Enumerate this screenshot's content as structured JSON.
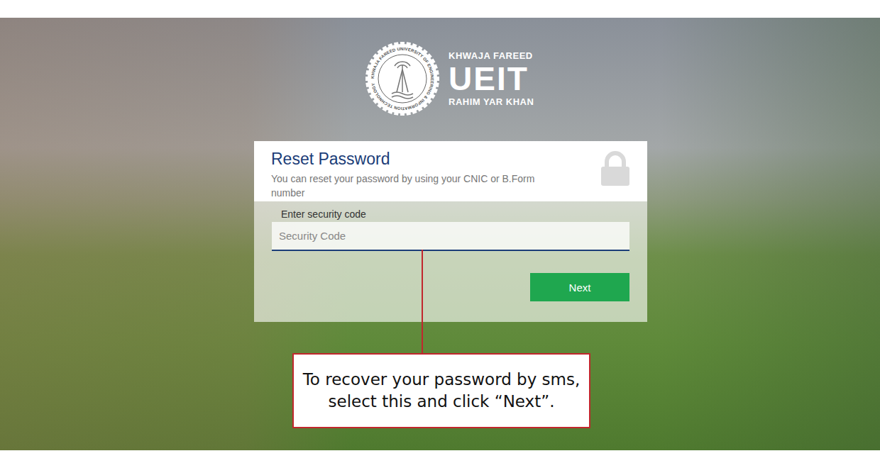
{
  "logo": {
    "seal_text": "KHWAJA FAREED UNIVERSITY OF ENGINEERING & INFORMATION TECHNOLOGY",
    "top": "KHWAJA FAREED",
    "name": "UEIT",
    "bottom": "RAHIM YAR KHAN"
  },
  "form": {
    "title": "Reset Password",
    "subtitle": "You can reset your password by using your CNIC or B.Form number",
    "field_label": "Enter security code",
    "field": {
      "placeholder": "Security Code",
      "value": ""
    },
    "button": "Next"
  },
  "callout": {
    "text": "To recover your password by sms, select this and click “Next”."
  }
}
